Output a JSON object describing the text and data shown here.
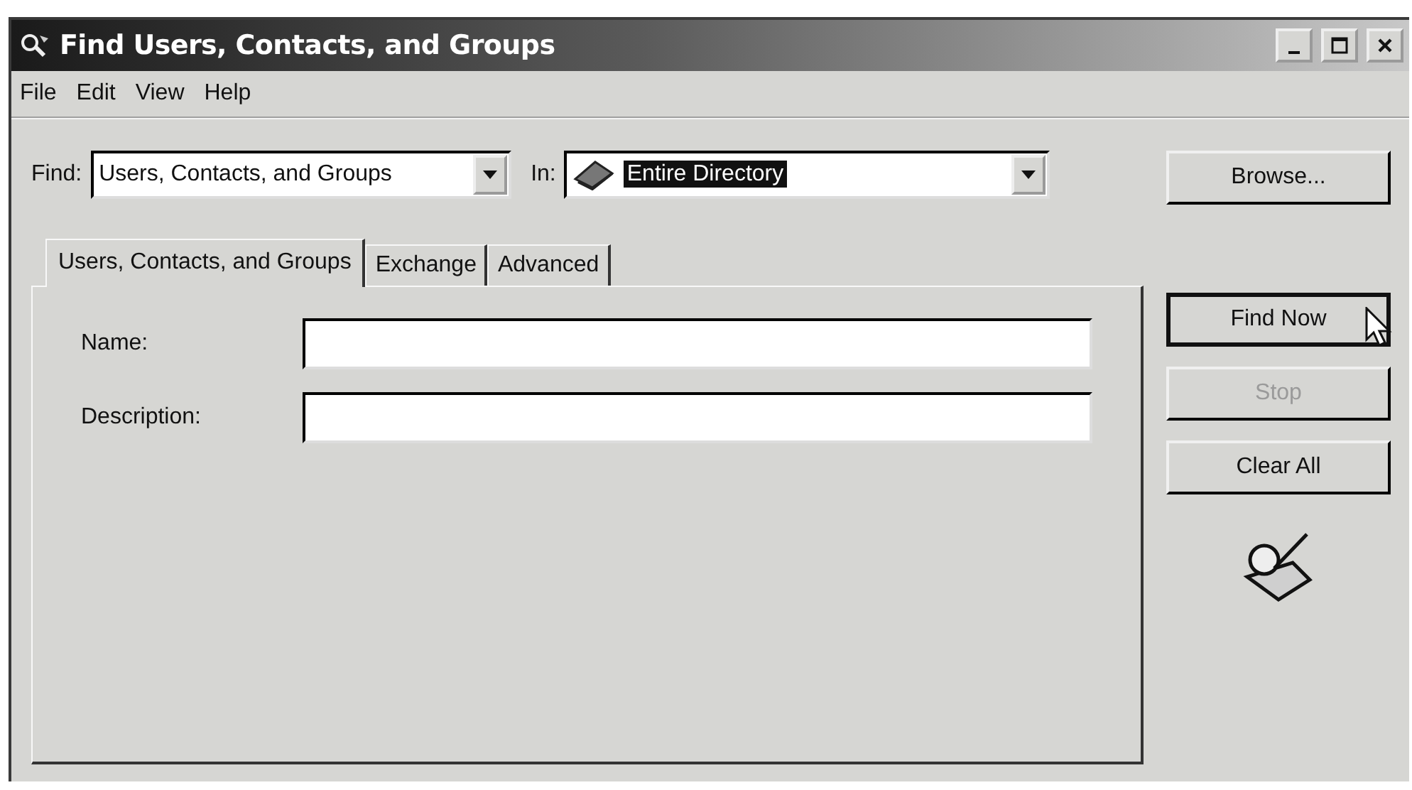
{
  "window": {
    "title": "Find Users, Contacts, and Groups"
  },
  "menu": [
    "File",
    "Edit",
    "View",
    "Help"
  ],
  "find": {
    "label": "Find:",
    "value": "Users, Contacts, and Groups"
  },
  "in": {
    "label": "In:",
    "value": "Entire Directory",
    "highlighted": true
  },
  "browse_button": {
    "label": "Browse..."
  },
  "tabs": [
    {
      "label": "Users, Contacts, and Groups",
      "selected": true
    },
    {
      "label": "Exchange",
      "selected": false
    },
    {
      "label": "Advanced",
      "selected": false
    }
  ],
  "fields": [
    {
      "label": "Name:"
    },
    {
      "label": "Description:"
    }
  ],
  "buttons": [
    {
      "label": "Find Now",
      "disabled": false,
      "default": true
    },
    {
      "label": "Stop",
      "disabled": true,
      "default": false
    },
    {
      "label": "Clear All",
      "disabled": false,
      "default": false
    }
  ]
}
